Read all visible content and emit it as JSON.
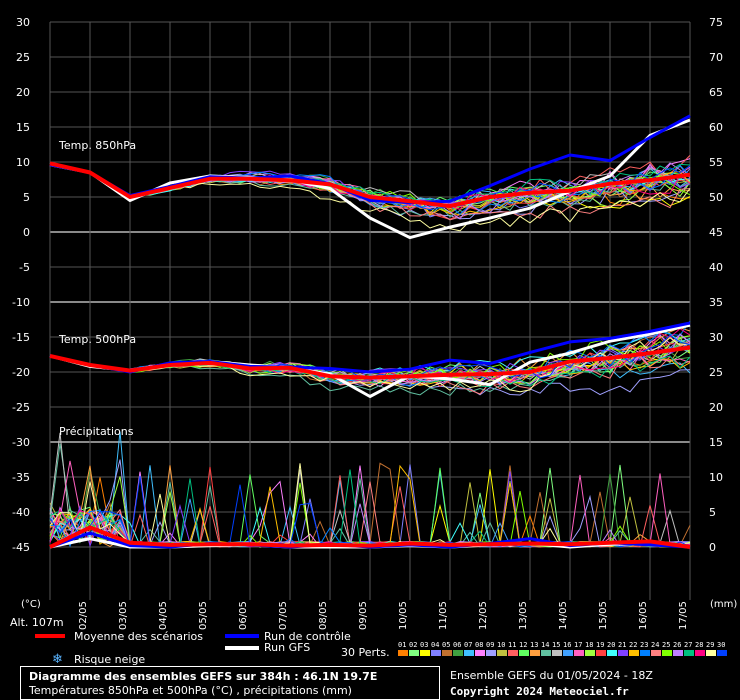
{
  "chart_data": {
    "type": "line",
    "title": "Diagramme des ensembles GEFS sur 384h : 46.1N 19.7E",
    "left_axis_unit": "(°C)",
    "right_axis_unit": "(mm)",
    "left_ticks": [
      30,
      25,
      20,
      15,
      10,
      5,
      0,
      -5,
      -10,
      -15,
      -20,
      -25,
      -30,
      -35,
      -40,
      -45
    ],
    "right_ticks": [
      75,
      70,
      65,
      60,
      55,
      50,
      45,
      40,
      35,
      30,
      25,
      20,
      15,
      10,
      5,
      0
    ],
    "left_ylim": [
      -45,
      30
    ],
    "right_ylim": [
      0,
      75
    ],
    "x_dates": [
      "02/05",
      "03/05",
      "04/05",
      "05/05",
      "06/05",
      "07/05",
      "08/05",
      "09/05",
      "10/05",
      "11/05",
      "12/05",
      "13/05",
      "14/05",
      "15/05",
      "16/05",
      "17/05"
    ],
    "section_labels": {
      "t850": "Temp. 850hPa",
      "t500": "Temp. 500hPa",
      "precip": "Précipitations"
    },
    "grid": true,
    "series": [
      {
        "name": "Moyenne des scénarios",
        "group": "t850",
        "color": "#ff0000",
        "values": [
          9.8,
          8.5,
          5.0,
          6.3,
          7.6,
          7.6,
          7.4,
          6.8,
          5.0,
          4.4,
          3.7,
          5.0,
          5.6,
          5.9,
          6.9,
          7.4,
          8.2
        ]
      },
      {
        "name": "Run de contrôle",
        "group": "t850",
        "color": "#0000ff",
        "values": [
          9.6,
          8.5,
          5.2,
          6.5,
          7.9,
          7.7,
          8.0,
          6.9,
          4.5,
          4.2,
          4.4,
          6.6,
          9.0,
          11.0,
          10.2,
          13.5,
          16.6
        ]
      },
      {
        "name": "Run GFS",
        "group": "t850",
        "color": "#ffffff",
        "values": [
          9.6,
          8.5,
          4.5,
          7.0,
          8.0,
          7.8,
          7.5,
          6.2,
          2.0,
          -0.8,
          0.7,
          2.0,
          3.4,
          5.8,
          8.0,
          13.8,
          16.0
        ]
      },
      {
        "name": "Moyenne des scénarios",
        "group": "t500",
        "color": "#ff0000",
        "values": [
          -17.7,
          -19.0,
          -19.8,
          -19.0,
          -18.7,
          -19.5,
          -19.4,
          -20.6,
          -20.8,
          -20.6,
          -20.4,
          -20.3,
          -20.0,
          -18.5,
          -18.0,
          -17.3,
          -16.5
        ]
      },
      {
        "name": "Run de contrôle",
        "group": "t500",
        "color": "#0000ff",
        "values": [
          -17.7,
          -19.0,
          -20.0,
          -18.7,
          -18.5,
          -19.2,
          -19.3,
          -19.5,
          -20.0,
          -19.6,
          -18.3,
          -18.8,
          -17.2,
          -15.7,
          -15.2,
          -14.2,
          -13.0
        ]
      },
      {
        "name": "Run GFS",
        "group": "t500",
        "color": "#ffffff",
        "values": [
          -17.7,
          -19.2,
          -19.8,
          -18.8,
          -18.5,
          -19.0,
          -19.4,
          -20.3,
          -23.5,
          -20.5,
          -21.0,
          -21.8,
          -18.6,
          -17.3,
          -15.6,
          -14.6,
          -13.3
        ]
      },
      {
        "name": "Moyenne des scénarios",
        "group": "precip",
        "color": "#ff0000",
        "values": [
          0,
          2.8,
          0.6,
          0.3,
          0.4,
          0.4,
          0.2,
          0.3,
          0.2,
          0.5,
          0.3,
          0.4,
          0.5,
          0.4,
          0.6,
          0.8,
          0
        ]
      },
      {
        "name": "Run de contrôle",
        "group": "precip",
        "color": "#0000ff",
        "values": [
          0,
          2.0,
          0.2,
          0,
          0.5,
          0.3,
          0,
          0.4,
          0,
          0.3,
          0,
          0.5,
          1.2,
          0.2,
          0.6,
          0.3,
          0
        ]
      },
      {
        "name": "Run GFS",
        "group": "precip",
        "color": "#ffffff",
        "values": [
          0,
          1.2,
          0,
          0,
          0.2,
          0.3,
          0,
          0,
          0,
          0.2,
          0,
          0.3,
          0.5,
          0,
          0.4,
          0.5,
          0
        ]
      }
    ]
  },
  "labels": {
    "altitude": "Alt. 107m",
    "unit_left": "(°C)",
    "unit_right": "(mm)",
    "perts": "30 Perts."
  },
  "legend": {
    "mean": "Moyenne des scénarios",
    "control": "Run de contrôle",
    "gfs": "Run GFS",
    "snow": "Risque neige",
    "colors": {
      "mean": "#ff0000",
      "control": "#0000ff",
      "gfs": "#ffffff",
      "snow": "#5ab4ff"
    }
  },
  "title_box": {
    "line1": "Diagramme des ensembles GEFS sur 384h : 46.1N 19.7E",
    "line2": "Températures 850hPa et 500hPa (°C) , précipitations (mm)"
  },
  "footer": {
    "run": "Ensemble GEFS du 01/05/2024 - 18Z",
    "copyright": "Copyright 2024 Meteociel.fr"
  },
  "perturbations": {
    "numbers": [
      "01",
      "02",
      "03",
      "04",
      "05",
      "06",
      "07",
      "08",
      "09",
      "10",
      "11",
      "12",
      "13",
      "14",
      "15",
      "16",
      "17",
      "18",
      "19",
      "20",
      "21",
      "22",
      "23",
      "24",
      "25",
      "26",
      "27",
      "28",
      "29",
      "30"
    ],
    "colors": [
      "#ff8000",
      "#80ff80",
      "#ffff00",
      "#8080ff",
      "#c07030",
      "#40a040",
      "#40c0ff",
      "#ff80ff",
      "#a0a0ff",
      "#c0c040",
      "#ff6060",
      "#60ff60",
      "#ffa040",
      "#60c0a0",
      "#c0c0c0",
      "#40a0ff",
      "#ff60c0",
      "#a0ff40",
      "#ff4040",
      "#40ffff",
      "#8040ff",
      "#ffc000",
      "#0080ff",
      "#ff8080",
      "#80ff00",
      "#c080ff",
      "#00c080",
      "#ff0080",
      "#ffffa0",
      "#0040ff"
    ]
  }
}
